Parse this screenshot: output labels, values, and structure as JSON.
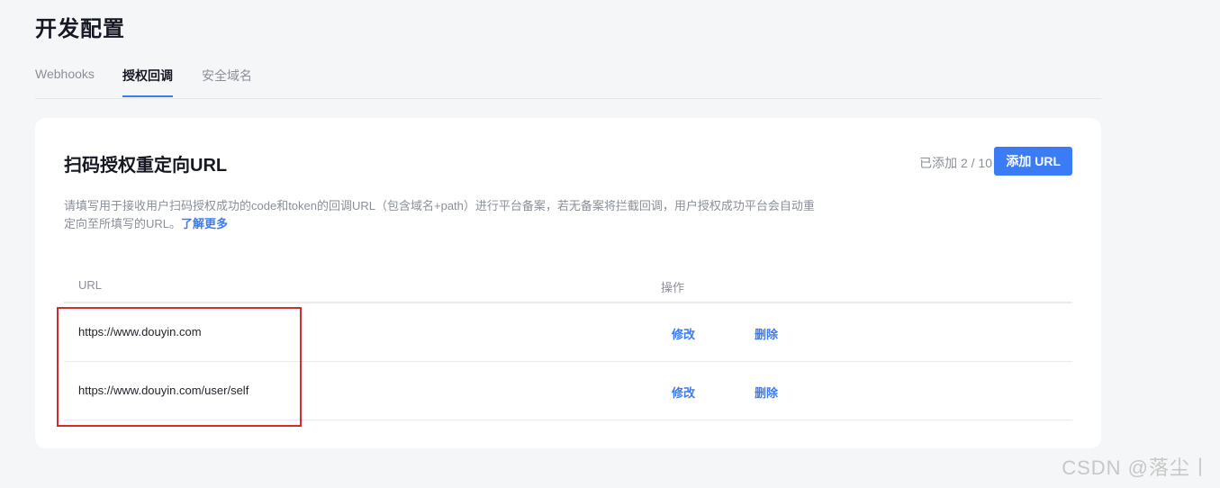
{
  "page": {
    "title": "开发配置"
  },
  "tabs": [
    {
      "label": "Webhooks",
      "active": false
    },
    {
      "label": "授权回调",
      "active": true
    },
    {
      "label": "安全域名",
      "active": false
    }
  ],
  "card": {
    "title": "扫码授权重定向URL",
    "count_text": "已添加 2 / 10",
    "add_button_label": "添加 URL",
    "description": "请填写用于接收用户扫码授权成功的code和token的回调URL（包含域名+path）进行平台备案，若无备案将拦截回调，用户授权成功平台会自动重定向至所填写的URL。",
    "learn_more_label": "了解更多"
  },
  "table": {
    "headers": {
      "url": "URL",
      "actions": "操作"
    },
    "rows": [
      {
        "url": "https://www.douyin.com",
        "edit_label": "修改",
        "delete_label": "删除"
      },
      {
        "url": "https://www.douyin.com/user/self",
        "edit_label": "修改",
        "delete_label": "删除"
      }
    ]
  },
  "watermark": "CSDN @落尘丨",
  "colors": {
    "accent": "#3c7bf6",
    "highlight_border": "#d62b2b",
    "background": "#f5f6f7"
  }
}
